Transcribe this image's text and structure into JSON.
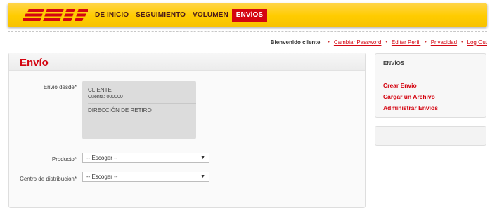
{
  "header": {
    "logo_text": "DHL",
    "nav": [
      {
        "label": "DE INICIO"
      },
      {
        "label": "SEGUIMIENTO"
      },
      {
        "label": "VOLUMEN"
      },
      {
        "label": "ENVÍOS",
        "active": true
      }
    ]
  },
  "userbar": {
    "welcome": "Bienvenido cliente",
    "links": [
      "Cambiar Password",
      "Editar Perfil",
      "Privacidad",
      "Log Out"
    ]
  },
  "main": {
    "title": "Envío",
    "origin": {
      "label": "Envio desde*",
      "client": "CLIENTE",
      "account": "Cuenta: 000000",
      "pickup": "DIRECCIÓN DE RETIRO"
    },
    "product": {
      "label": "Producto*",
      "value": "-- Escoger --"
    },
    "center": {
      "label": "Centro de distribucion*",
      "value": "-- Escoger --"
    }
  },
  "sidebar": {
    "heading": "ENVÍOS",
    "links": [
      "Crear Envio",
      "Cargar un Archivo",
      "Administrar Envios"
    ]
  },
  "colors": {
    "brand_yellow": "#ffcc00",
    "brand_red": "#d40511"
  }
}
